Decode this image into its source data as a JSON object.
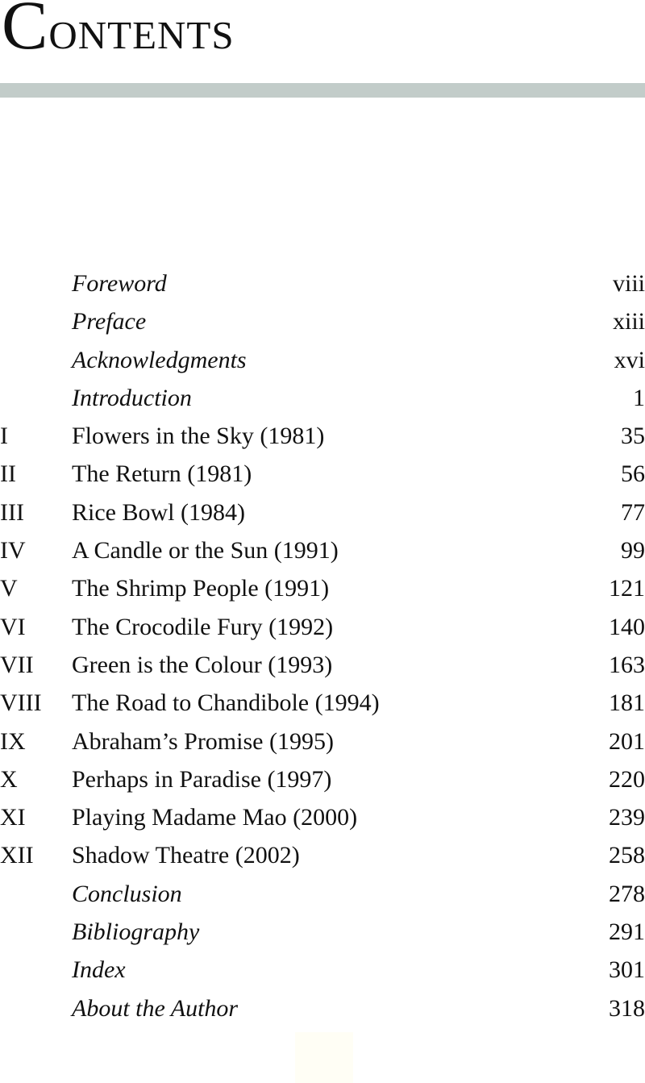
{
  "page": {
    "heading_first": "C",
    "heading_rest": "ontents",
    "heading_full": "Contents",
    "accent_bar_color": "#c2ccc9"
  },
  "toc": {
    "entries": [
      {
        "number": "",
        "title": "Foreword",
        "page": "viii",
        "italic": true
      },
      {
        "number": "",
        "title": "Preface",
        "page": "xiii",
        "italic": true
      },
      {
        "number": "",
        "title": "Acknowledgments",
        "page": "xvi",
        "italic": true
      },
      {
        "number": "",
        "title": "Introduction",
        "page": "1",
        "italic": true
      },
      {
        "number": "I",
        "title": "Flowers in the Sky (1981)",
        "page": "35",
        "italic": false
      },
      {
        "number": "II",
        "title": "The Return (1981)",
        "page": "56",
        "italic": false
      },
      {
        "number": "III",
        "title": "Rice Bowl (1984)",
        "page": "77",
        "italic": false
      },
      {
        "number": "IV",
        "title": "A Candle or the Sun (1991)",
        "page": "99",
        "italic": false
      },
      {
        "number": "V",
        "title": "The Shrimp People (1991)",
        "page": "121",
        "italic": false
      },
      {
        "number": "VI",
        "title": "The Crocodile Fury (1992)",
        "page": "140",
        "italic": false
      },
      {
        "number": "VII",
        "title": "Green is the Colour (1993)",
        "page": "163",
        "italic": false
      },
      {
        "number": "VIII",
        "title": "The Road to Chandibole (1994)",
        "page": "181",
        "italic": false
      },
      {
        "number": "IX",
        "title": "Abraham’s Promise (1995)",
        "page": "201",
        "italic": false
      },
      {
        "number": "X",
        "title": "Perhaps in Paradise (1997)",
        "page": "220",
        "italic": false
      },
      {
        "number": "XI",
        "title": "Playing Madame Mao (2000)",
        "page": "239",
        "italic": false
      },
      {
        "number": "XII",
        "title": "Shadow Theatre (2002)",
        "page": "258",
        "italic": false
      },
      {
        "number": "",
        "title": "Conclusion",
        "page": "278",
        "italic": true
      },
      {
        "number": "",
        "title": "Bibliography",
        "page": "291",
        "italic": true
      },
      {
        "number": "",
        "title": "Index",
        "page": "301",
        "italic": true
      },
      {
        "number": "",
        "title": "About the Author",
        "page": "318",
        "italic": true
      }
    ]
  }
}
